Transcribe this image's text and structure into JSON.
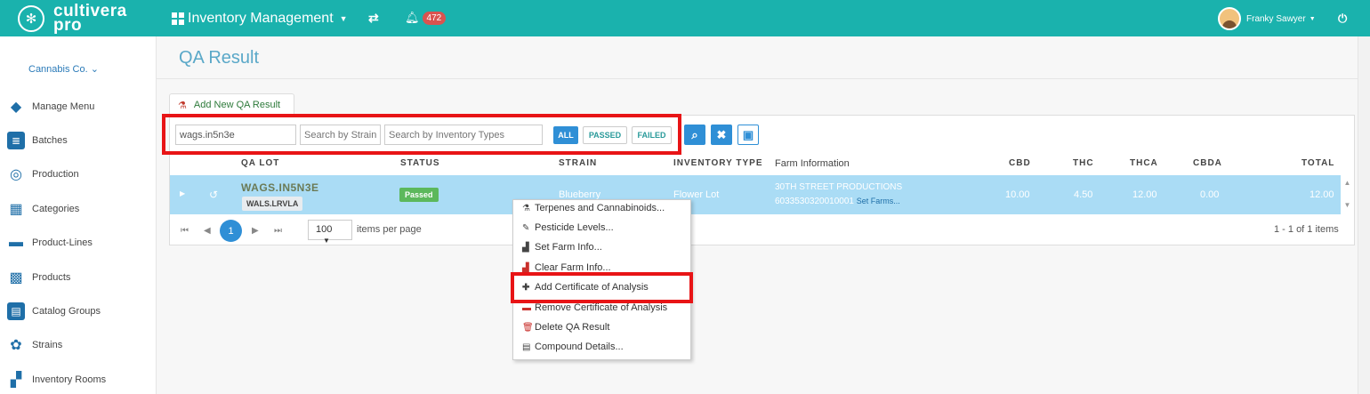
{
  "topbar": {
    "brand_line1": "cultivera",
    "brand_line2": "pro",
    "module": "Inventory Management",
    "notifications": "472",
    "user": "Franky Sawyer"
  },
  "sidebar": {
    "company": "Cannabis Co.",
    "items": [
      {
        "label": "Manage Menu",
        "icon": "tag-icon"
      },
      {
        "label": "Batches",
        "icon": "list-icon"
      },
      {
        "label": "Production",
        "icon": "cycle-icon"
      },
      {
        "label": "Categories",
        "icon": "table-icon"
      },
      {
        "label": "Product-Lines",
        "icon": "rows-icon"
      },
      {
        "label": "Products",
        "icon": "grid-icon"
      },
      {
        "label": "Catalog Groups",
        "icon": "catalog-icon"
      },
      {
        "label": "Strains",
        "icon": "strain-icon"
      },
      {
        "label": "Inventory Rooms",
        "icon": "rooms-icon"
      }
    ]
  },
  "page": {
    "title": "QA Result",
    "add_tab": "Add New QA Result"
  },
  "filters": {
    "search_value": "wags.in5n3e",
    "strain_placeholder": "Search by Strain",
    "type_placeholder": "Search by Inventory Types",
    "all": "ALL",
    "passed": "PASSED",
    "failed": "FAILED"
  },
  "table": {
    "headers": {
      "qa_lot": "QA LOT",
      "status": "STATUS",
      "strain": "STRAIN",
      "inventory_type": "INVENTORY TYPE",
      "farm": "Farm Information",
      "cbd": "CBD",
      "thc": "THC",
      "thca": "THCA",
      "cbda": "CBDA",
      "total": "TOTAL"
    },
    "row": {
      "lot": "WAGS.IN5N3E",
      "lot_sub": "WALS.LRVLA",
      "status": "Passed",
      "strain": "Blueberry",
      "inventory_type": "Flower Lot",
      "farm_name": "30TH STREET PRODUCTIONS",
      "farm_id": "6033530320010001",
      "farm_link": "Set Farms...",
      "cbd": "10.00",
      "thc": "4.50",
      "thca": "12.00",
      "cbda": "0.00",
      "total": "12.00"
    }
  },
  "pager": {
    "current_page": "1",
    "per_page": "100",
    "per_page_label": "items per page",
    "info": "1 - 1 of 1 items"
  },
  "context_menu": [
    "Terpenes and Cannabinoids...",
    "Pesticide Levels...",
    "Set Farm Info...",
    "Clear Farm Info...",
    "Add Certificate of Analysis",
    "Remove Certificate of Analysis",
    "Delete QA Result",
    "Compound Details..."
  ],
  "colors": {
    "topbar": "#1ab2ad",
    "highlight": "#e81416",
    "row_selected": "#aadcf5",
    "primary": "#2f8fd6"
  }
}
